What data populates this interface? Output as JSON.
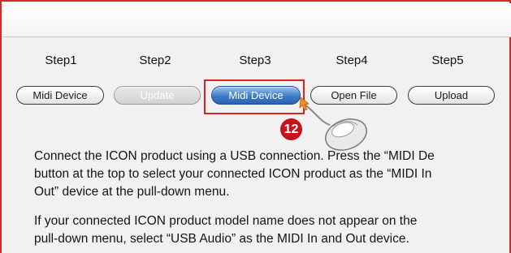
{
  "steps": [
    {
      "label": "Step1",
      "button": "Midi Device"
    },
    {
      "label": "Step2",
      "button": "Update"
    },
    {
      "label": "Step3",
      "button": "Midi Device"
    },
    {
      "label": "Step4",
      "button": "Open File"
    },
    {
      "label": "Step5",
      "button": "Upload"
    }
  ],
  "callout": {
    "number": "12"
  },
  "instructions": {
    "p1": [
      "Connect the ICON product using a USB connection. Press the “MIDI De",
      "button at the top to select your connected ICON product as the “MIDI In",
      "Out” device at the pull-down menu."
    ],
    "p2": [
      "If your connected ICON product model name does not appear on the",
      "pull-down menu, select “USB Audio” as the MIDI In and Out device."
    ]
  },
  "colors": {
    "highlight": "#e0201b",
    "badge": "#c7121a",
    "active_button": "#3c7cc6"
  },
  "icons": [
    "mouse-icon",
    "pointer-arrow-icon"
  ]
}
